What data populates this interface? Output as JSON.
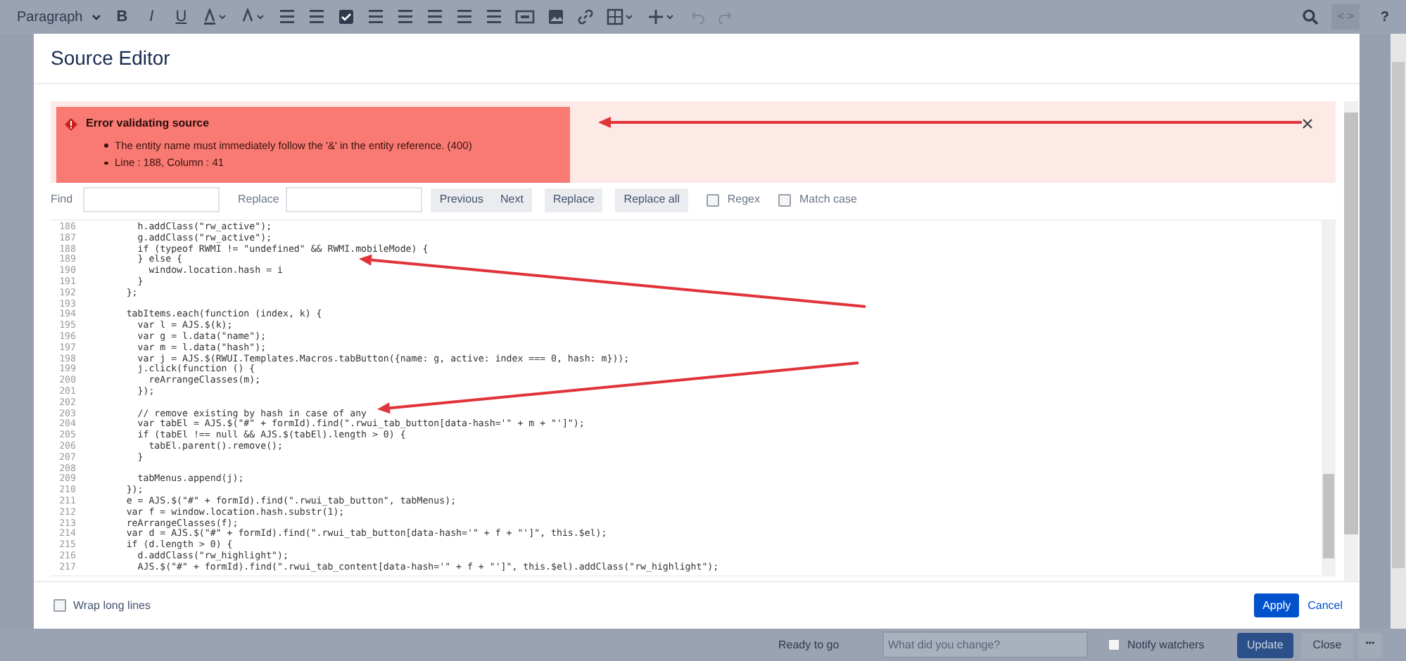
{
  "toolbar": {
    "style_dropdown": "Paragraph",
    "format_buttons": [
      "B",
      "I",
      "U"
    ],
    "source_button": "< >",
    "help_button": "?"
  },
  "dialog": {
    "title": "Source Editor",
    "error": {
      "title": "Error validating source",
      "messages": [
        "The entity name must immediately follow the '&' in the entity reference. (400)",
        "Line : 188, Column : 41"
      ]
    },
    "find_bar": {
      "find_label": "Find",
      "replace_label": "Replace",
      "buttons": [
        "Previous",
        "Next",
        "Replace",
        "Replace all"
      ],
      "options": [
        {
          "label": "Regex",
          "checked": false
        },
        {
          "label": "Match case",
          "checked": false
        }
      ]
    },
    "code_lines": [
      {
        "number": "186",
        "text": "        h.addClass(\"rw_active\");"
      },
      {
        "number": "187",
        "text": "        g.addClass(\"rw_active\");"
      },
      {
        "number": "188",
        "text": "        if (typeof RWMI != \"undefined\" && RWMI.mobileMode) {"
      },
      {
        "number": "189",
        "text": "        } else {"
      },
      {
        "number": "190",
        "text": "          window.location.hash = i"
      },
      {
        "number": "191",
        "text": "        }"
      },
      {
        "number": "192",
        "text": "      };"
      },
      {
        "number": "193"
      },
      {
        "number": "194",
        "text": "      tabItems.each(function (index, k) {"
      },
      {
        "number": "195",
        "text": "        var l = AJS.$(k);"
      },
      {
        "number": "196",
        "text": "        var g = l.data(\"name\");"
      },
      {
        "number": "197",
        "text": "        var m = l.data(\"hash\");"
      },
      {
        "number": "198",
        "text": "        var j = AJS.$(RWUI.Templates.Macros.tabButton({name: g, active: index === 0, hash: m}));"
      },
      {
        "number": "199",
        "text": "        j.click(function () {"
      },
      {
        "number": "200",
        "text": "          reArrangeClasses(m);"
      },
      {
        "number": "201",
        "text": "        });"
      },
      {
        "number": "202"
      },
      {
        "number": "203",
        "text": "        // remove existing by hash in case of any"
      },
      {
        "number": "204",
        "text": "        var tabEl = AJS.$(\"#\" + formId).find(\".rwui_tab_button[data-hash='\" + m + \"']\");"
      },
      {
        "number": "205",
        "text": "        if (tabEl !== null && AJS.$(tabEl).length > 0) {"
      },
      {
        "number": "206",
        "text": "          tabEl.parent().remove();"
      },
      {
        "number": "207",
        "text": "        }"
      },
      {
        "number": "208"
      },
      {
        "number": "209",
        "text": "        tabMenus.append(j);"
      },
      {
        "number": "210",
        "text": "      });"
      },
      {
        "number": "211",
        "text": "      e = AJS.$(\"#\" + formId).find(\".rwui_tab_button\", tabMenus);"
      },
      {
        "number": "212",
        "text": "      var f = window.location.hash.substr(1);"
      },
      {
        "number": "213",
        "text": "      reArrangeClasses(f);"
      },
      {
        "number": "214",
        "text": "      var d = AJS.$(\"#\" + formId).find(\".rwui_tab_button[data-hash='\" + f + \"']\", this.$el);"
      },
      {
        "number": "215",
        "text": "      if (d.length > 0) {"
      },
      {
        "number": "216",
        "text": "        d.addClass(\"rw_highlight\");"
      },
      {
        "number": "217",
        "text": "        AJS.$(\"#\" + formId).find(\".rwui_tab_content[data-hash='\" + f + \"']\", this.$el).addClass(\"rw_highlight\");"
      }
    ],
    "wrap_option": {
      "label": "Wrap long lines",
      "checked": false
    },
    "apply_button": "Apply",
    "cancel_link": "Cancel"
  },
  "bottom_bar": {
    "status": "Ready to go",
    "change_field": {
      "placeholder": "What did you change?"
    },
    "notify": {
      "label": "Notify watchers",
      "checked": false
    },
    "update_button": "Update",
    "close_button": "Close",
    "more_button": "•••"
  }
}
